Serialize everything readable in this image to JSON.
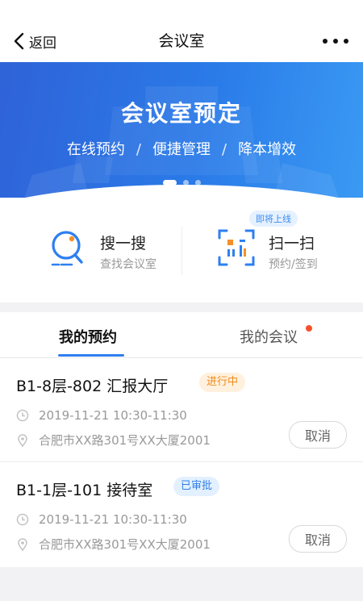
{
  "nav": {
    "back_label": "返回",
    "title": "会议室"
  },
  "banner": {
    "title": "会议室预定",
    "subtitles": [
      "在线预约",
      "便捷管理",
      "降本增效"
    ],
    "separator": "/",
    "slides_total": 3,
    "slide_active": 1
  },
  "actions": {
    "search": {
      "label": "搜一搜",
      "desc": "查找会议室",
      "icon": "search-magnifier-icon"
    },
    "scan": {
      "label": "扫一扫",
      "desc": "预约/签到",
      "badge": "即将上线",
      "icon": "qr-scan-icon"
    }
  },
  "tabs": [
    {
      "label": "我的预约",
      "active": true
    },
    {
      "label": "我的会议",
      "active": false,
      "has_dot": true
    }
  ],
  "reservations": [
    {
      "name": "B1-8层-802 汇报大厅",
      "status": "进行中",
      "time": "2019-11-21 10:30-11:30",
      "address": "合肥市XX路301号XX大厦2001",
      "cancel_label": "取消"
    },
    {
      "name": "B1-1层-101 接待室",
      "status": "已审批",
      "time": "2019-11-21 10:30-11:30",
      "address": "合肥市XX路301号XX大厦2001",
      "cancel_label": "取消"
    }
  ],
  "colors": {
    "accent": "#2e7ff0",
    "status_going": "#f08a1c",
    "status_approved": "#2f7fe8",
    "dot": "#f5502a"
  }
}
